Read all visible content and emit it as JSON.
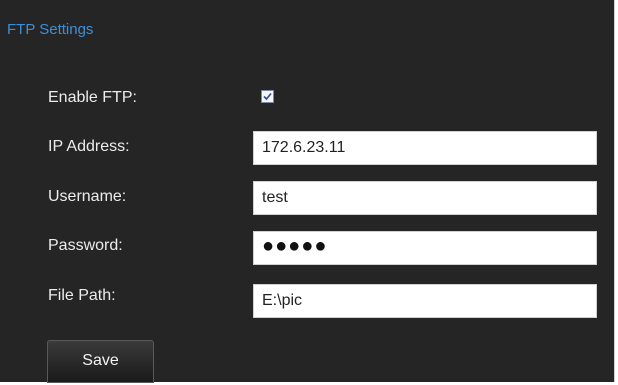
{
  "panel": {
    "title": "FTP Settings"
  },
  "form": {
    "enable_ftp": {
      "label": "Enable FTP:",
      "checked": true
    },
    "ip_address": {
      "label": "IP Address:",
      "value": "172.6.23.11"
    },
    "username": {
      "label": "Username:",
      "value": "test"
    },
    "password": {
      "label": "Password:",
      "masked_value": "●●●●●"
    },
    "file_path": {
      "label": "File Path:",
      "value": "E:\\pic"
    }
  },
  "actions": {
    "save_label": "Save"
  },
  "colors": {
    "panel_background": "#252525",
    "title_accent": "#3b8fd9",
    "label_text": "#ececec"
  }
}
